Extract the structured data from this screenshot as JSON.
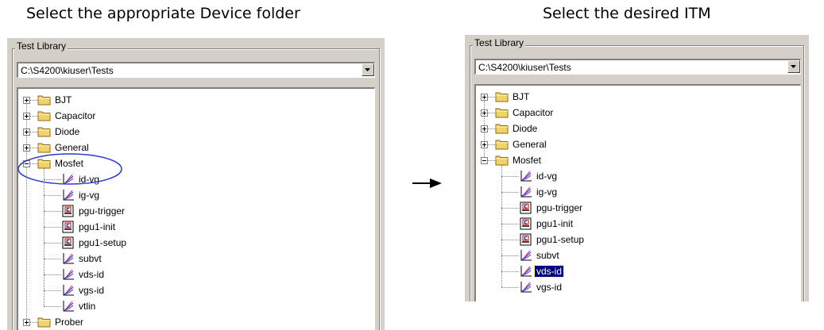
{
  "headings": {
    "left": "Select the appropriate Device folder",
    "right": "Select the desired ITM"
  },
  "left_panel": {
    "group_label": "Test Library",
    "path": "C:\\S4200\\kiuser\\Tests",
    "tree": [
      {
        "label": "BJT",
        "type": "folder",
        "level": 0,
        "expanded": false
      },
      {
        "label": "Capacitor",
        "type": "folder",
        "level": 0,
        "expanded": false
      },
      {
        "label": "Diode",
        "type": "folder",
        "level": 0,
        "expanded": false
      },
      {
        "label": "General",
        "type": "folder",
        "level": 0,
        "expanded": false
      },
      {
        "label": "Mosfet",
        "type": "folder",
        "level": 0,
        "expanded": true
      },
      {
        "label": "id-vg",
        "type": "itm",
        "level": 1
      },
      {
        "label": "ig-vg",
        "type": "itm",
        "level": 1
      },
      {
        "label": "pgu-trigger",
        "type": "ucm",
        "level": 1
      },
      {
        "label": "pgu1-init",
        "type": "ucm",
        "level": 1
      },
      {
        "label": "pgu1-setup",
        "type": "ucm",
        "level": 1
      },
      {
        "label": "subvt",
        "type": "itm",
        "level": 1
      },
      {
        "label": "vds-id",
        "type": "itm",
        "level": 1
      },
      {
        "label": "vgs-id",
        "type": "itm",
        "level": 1
      },
      {
        "label": "vtlin",
        "type": "itm",
        "level": 1
      },
      {
        "label": "Prober",
        "type": "folder",
        "level": 0,
        "expanded": false
      }
    ]
  },
  "right_panel": {
    "group_label": "Test Library",
    "path": "C:\\S4200\\kiuser\\Tests",
    "selected": "vds-id",
    "tree": [
      {
        "label": "BJT",
        "type": "folder",
        "level": 0,
        "expanded": false
      },
      {
        "label": "Capacitor",
        "type": "folder",
        "level": 0,
        "expanded": false
      },
      {
        "label": "Diode",
        "type": "folder",
        "level": 0,
        "expanded": false
      },
      {
        "label": "General",
        "type": "folder",
        "level": 0,
        "expanded": false
      },
      {
        "label": "Mosfet",
        "type": "folder",
        "level": 0,
        "expanded": true
      },
      {
        "label": "id-vg",
        "type": "itm",
        "level": 1
      },
      {
        "label": "ig-vg",
        "type": "itm",
        "level": 1
      },
      {
        "label": "pgu-trigger",
        "type": "ucm",
        "level": 1
      },
      {
        "label": "pgu1-init",
        "type": "ucm",
        "level": 1
      },
      {
        "label": "pgu1-setup",
        "type": "ucm",
        "level": 1
      },
      {
        "label": "subvt",
        "type": "itm",
        "level": 1
      },
      {
        "label": "vds-id",
        "type": "itm",
        "level": 1
      },
      {
        "label": "vgs-id",
        "type": "itm",
        "level": 1
      }
    ]
  },
  "icons": {
    "expander": "plus-minus-box-icon",
    "folder": "folder-icon",
    "itm": "itm-graph-icon",
    "ucm": "ucm-module-icon",
    "combo_arrow": "chevron-down-icon",
    "arrow": "right-arrow-icon"
  },
  "colors": {
    "selection": "#000080",
    "highlight_oval": "#2a3cc8",
    "folder": "#f2d36b"
  }
}
